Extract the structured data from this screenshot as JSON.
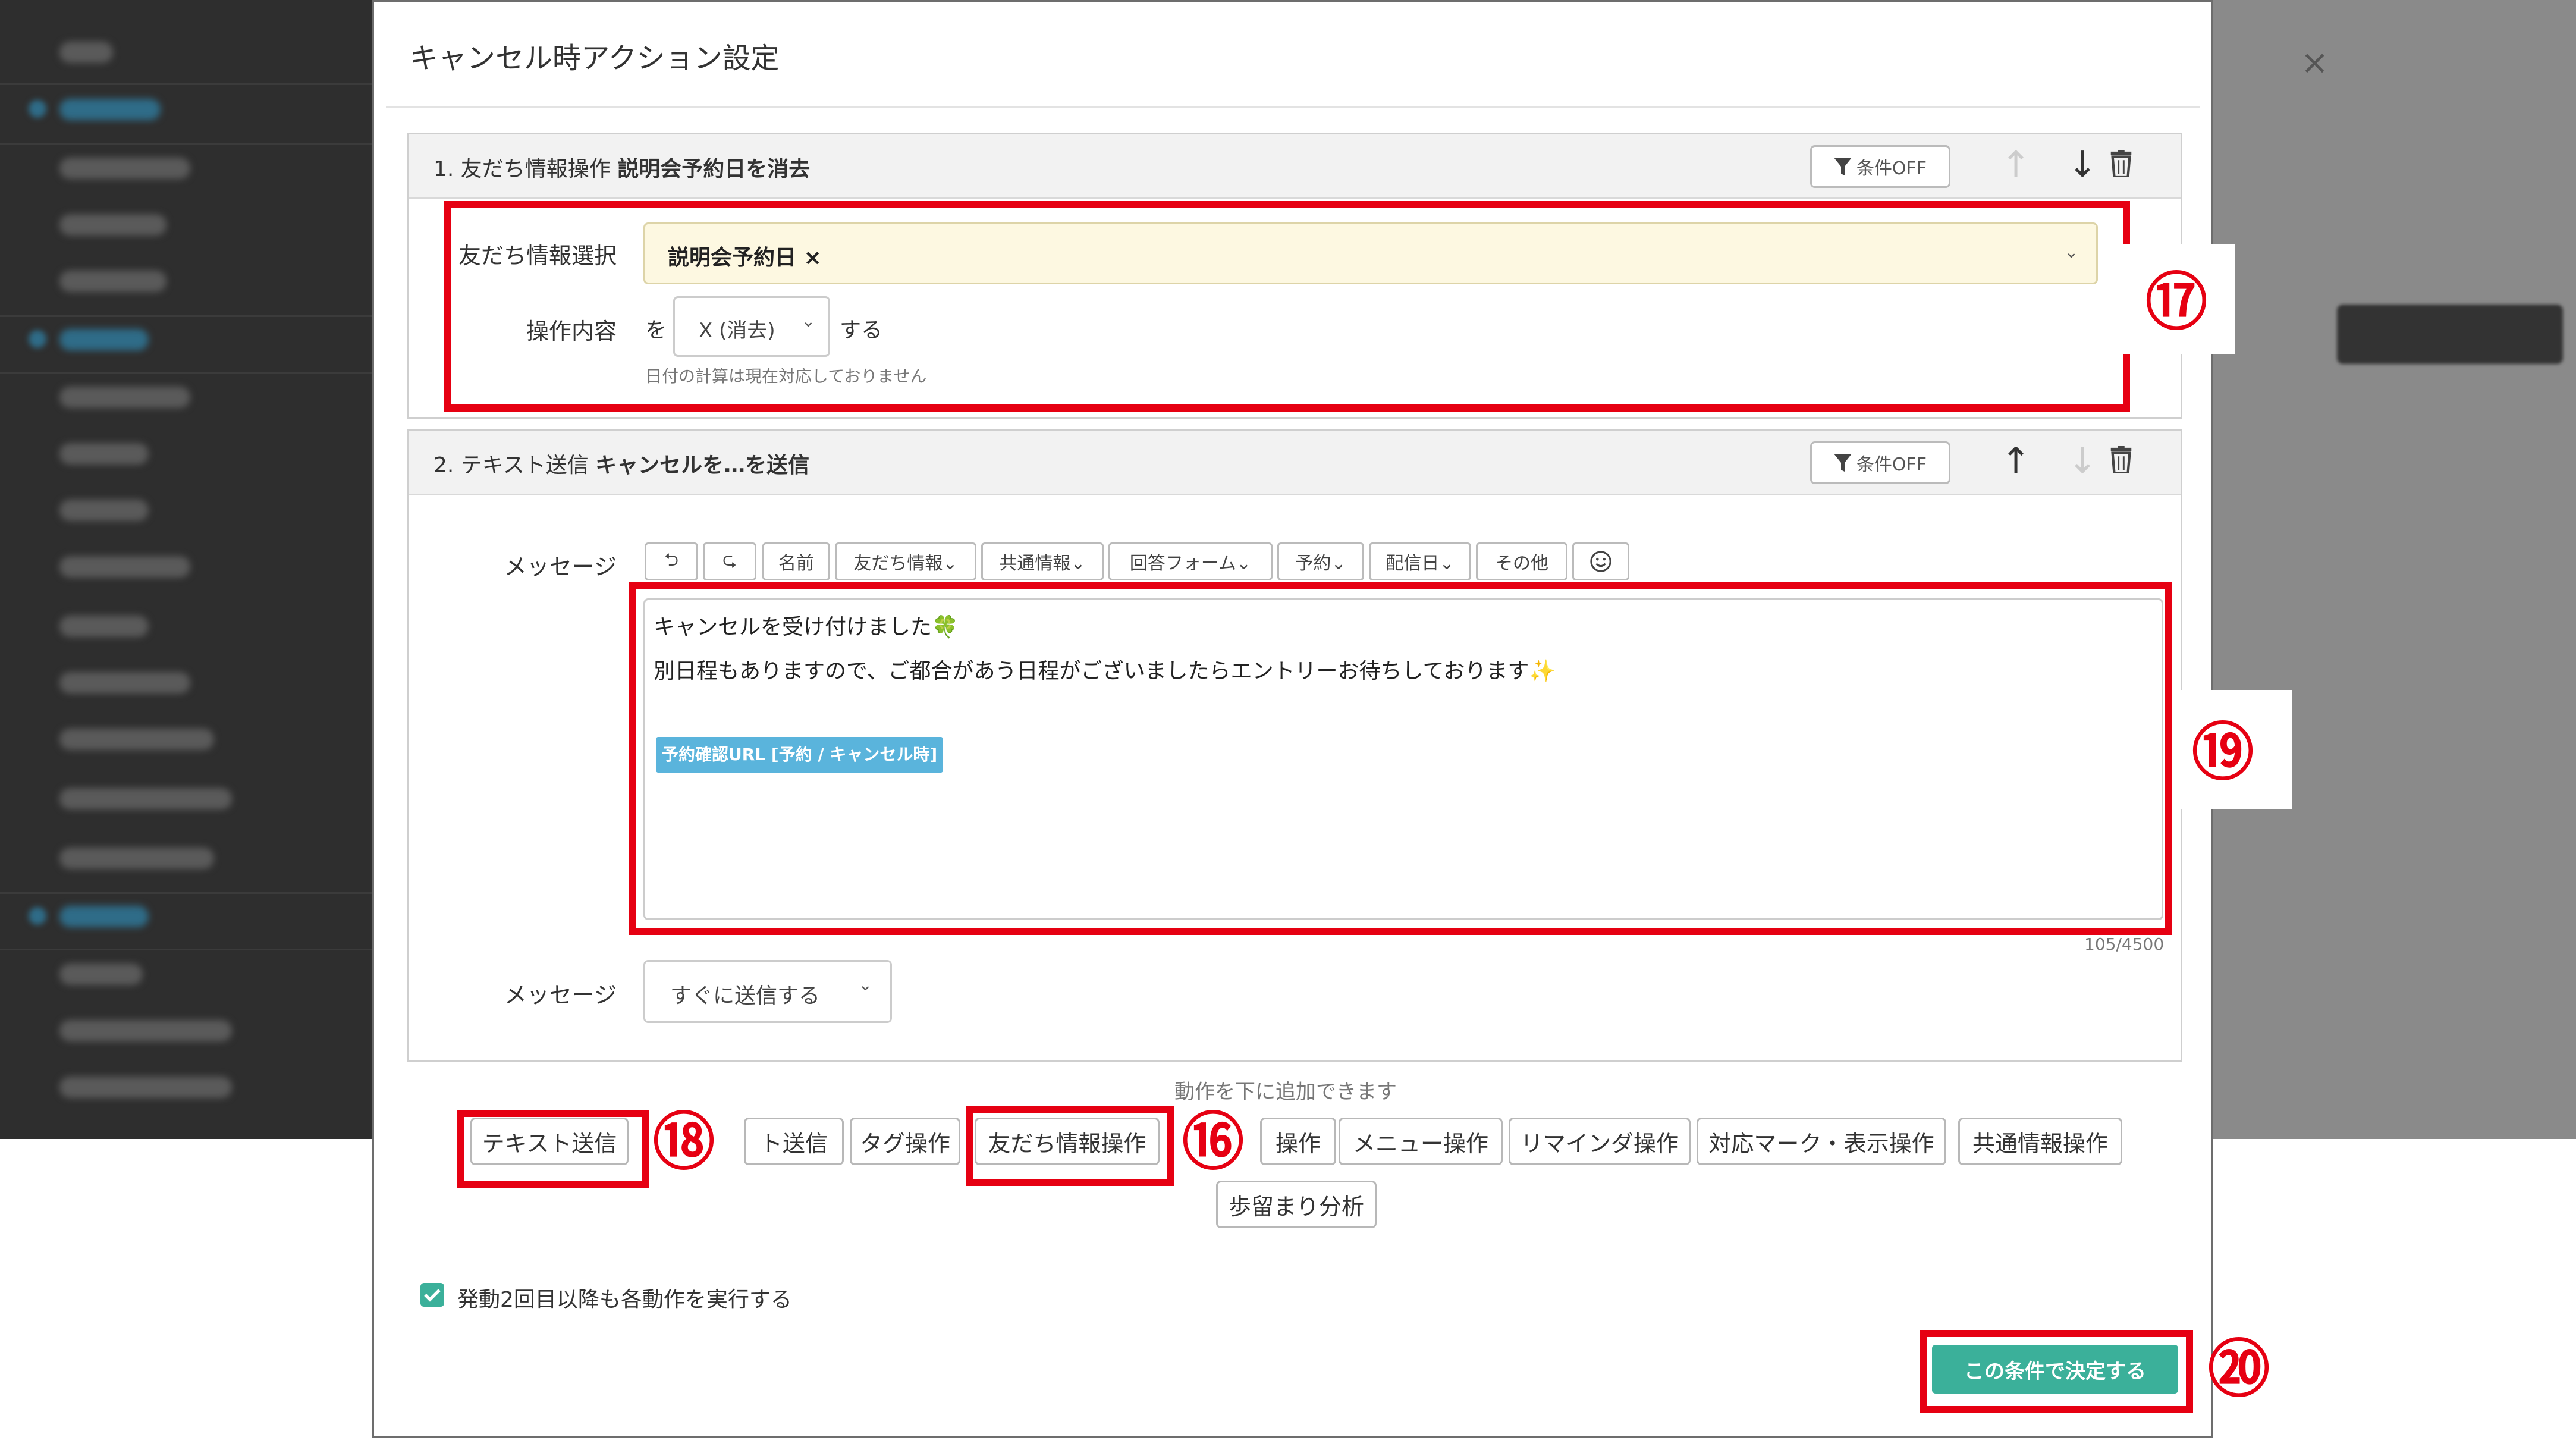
{
  "modal": {
    "title": "キャンセル時アクション設定",
    "close": "×"
  },
  "action1": {
    "index": "1. 友だち情報操作",
    "name": "説明会予約日を消去",
    "cond_label": "条件OFF",
    "field_label": "友だち情報選択",
    "selected_tag": "説明会予約日 ×",
    "op_label": "操作内容",
    "op_prefix": "を",
    "op_value": "X (消去)",
    "op_suffix": "する",
    "note": "日付の計算は現在対応しておりません"
  },
  "action2": {
    "index": "2. テキスト送信",
    "name": "キャンセルを…を送信",
    "cond_label": "条件OFF",
    "message_label": "メッセージ",
    "toolbar": [
      "⮌",
      "⮎",
      "名前",
      "友だち情報⌄",
      "共通情報⌄",
      "回答フォーム⌄",
      "予約⌄",
      "配信日⌄",
      "その他"
    ],
    "message_lines": [
      "キャンセルを受け付けました🍀",
      "別日程もありますので、ご都合があう日程がございましたらエントリーお待ちしております✨"
    ],
    "url_chip": "予約確認URL [予約 / キャンセル時]",
    "char_count": "105/4500",
    "timing_label": "メッセージ",
    "timing_value": "すぐに送信する"
  },
  "add_hint": "動作を下に追加できます",
  "add_buttons": [
    "テキスト送信",
    "ト送信",
    "タグ操作",
    "友だち情報操作",
    "操作",
    "メニュー操作",
    "リマインダ操作",
    "対応マーク・表示操作",
    "共通情報操作",
    "歩留まり分析"
  ],
  "repeat_checkbox": {
    "label": "発動2回目以降も各動作を実行する",
    "checked": true
  },
  "submit": "この条件で決定する",
  "annotations": [
    "⑰",
    "⑱",
    "⑯",
    "⑲",
    "⑳"
  ],
  "colors": {
    "accent": "#3bb09a",
    "highlight": "#e60012",
    "tag_bg": "#fdf8e1",
    "chip": "#5ab4dc"
  }
}
